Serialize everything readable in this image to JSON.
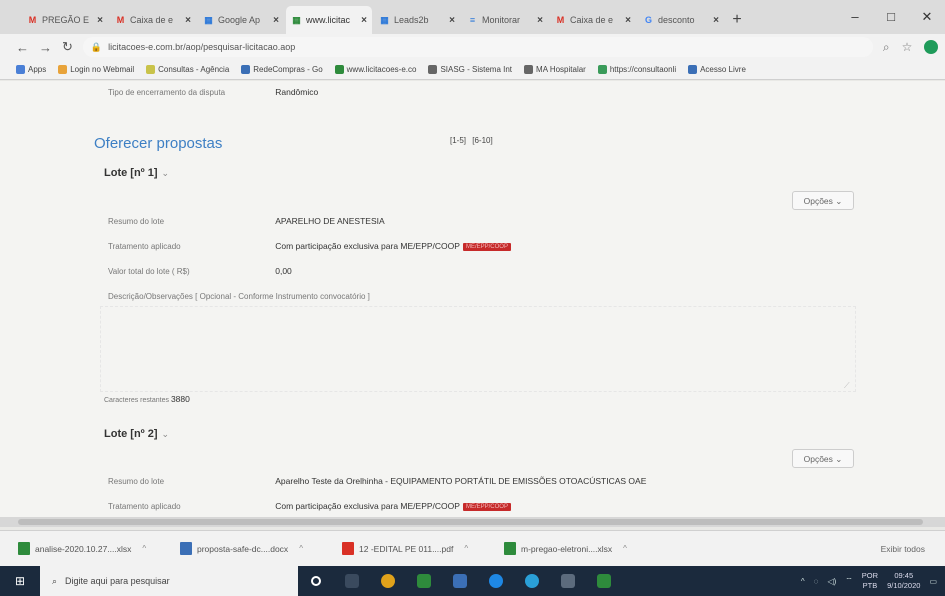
{
  "browser": {
    "tabs": [
      {
        "icon": "M",
        "icon_color": "#d93025",
        "title": "PREGÃO E",
        "active": false
      },
      {
        "icon": "M",
        "icon_color": "#d93025",
        "title": "Caixa de e",
        "active": false
      },
      {
        "icon": "▦",
        "icon_color": "#2f7ad9",
        "title": "Google Ap",
        "active": false
      },
      {
        "icon": "▦",
        "icon_color": "#2e8b3c",
        "title": "www.licitac",
        "active": true
      },
      {
        "icon": "▦",
        "icon_color": "#2f7ad9",
        "title": "Leads2b",
        "active": false
      },
      {
        "icon": "≡",
        "icon_color": "#2f7ad9",
        "title": "Monitorar",
        "active": false
      },
      {
        "icon": "M",
        "icon_color": "#d93025",
        "title": "Caixa de e",
        "active": false
      },
      {
        "icon": "G",
        "icon_color": "#4285f4",
        "title": "desconto",
        "active": false
      }
    ],
    "new_tab": "+",
    "minimize": "–",
    "maximize": "□",
    "close": "✕",
    "url": "licitacoes-e.com.br/aop/pesquisar-licitacao.aop",
    "bookmarks": [
      {
        "label": "Apps",
        "color": "#4a7fd6"
      },
      {
        "label": "Login no Webmail",
        "color": "#e8a33a"
      },
      {
        "label": "Consultas - Agência",
        "color": "#c9c34a"
      },
      {
        "label": "RedeCompras - Go",
        "color": "#3b6fb6"
      },
      {
        "label": "www.licitacoes-e.co",
        "color": "#2e8b3c"
      },
      {
        "label": "SIASG - Sistema Int",
        "color": "#666666"
      },
      {
        "label": "MA Hospitalar",
        "color": "#666666"
      },
      {
        "label": "https://consultaonli",
        "color": "#3a9b5a"
      },
      {
        "label": "Acesso Livre",
        "color": "#3b6fb6"
      }
    ]
  },
  "page": {
    "tipo_label": "Tipo de encerramento da disputa",
    "tipo_value": "Randômico",
    "pager": [
      "[1-5]",
      "[6-10]"
    ],
    "section_title": "Oferecer propostas",
    "lote1": {
      "title": "Lote [nº 1]",
      "dropdown": "⌄",
      "options_label": "Opções ⌄",
      "resumo_label": "Resumo do lote",
      "resumo_value": "APARELHO DE ANESTESIA",
      "tratamento_label": "Tratamento aplicado",
      "tratamento_value": "Com participação exclusiva para ME/EPP/COOP",
      "tratamento_tag": "ME/EPP/COOP",
      "valor_label": "Valor total do lote ( R$)",
      "valor_value": "0,00",
      "descricao_label": "Descrição/Observações [ Opcional - Conforme Instrumento convocatório ]",
      "resize_mark": "⟋"
    },
    "caracteres_label": "Caracteres restantes",
    "caracteres_value": "3880",
    "lote2": {
      "title": "Lote [nº 2]",
      "dropdown": "⌄",
      "options_label": "Opções ⌄",
      "resumo_label": "Resumo do lote",
      "resumo_value": "Aparelho Teste da Orelhinha - EQUIPAMENTO PORTÁTIL DE EMISSÕES OTOACÚSTICAS OAE",
      "tratamento_label": "Tratamento aplicado",
      "tratamento_value": "Com participação exclusiva para ME/EPP/COOP",
      "tratamento_tag": "ME/EPP/COOP"
    }
  },
  "downloads": {
    "items": [
      {
        "name": "analise-2020.10.27....xlsx",
        "color": "#2e8b3c"
      },
      {
        "name": "proposta-safe-dc....docx",
        "color": "#3b6fb6"
      },
      {
        "name": "12 -EDITAL PE 011....pdf",
        "color": "#d93025"
      },
      {
        "name": "m-pregao-eletroni....xlsx",
        "color": "#2e8b3c"
      }
    ],
    "chevron": "^",
    "show_all": "Exibir todos"
  },
  "taskbar": {
    "start": "⊞",
    "search_placeholder": "Digite aqui para pesquisar",
    "search_icon": "⌕",
    "clock_time": "09:45",
    "clock_date": "9/10/2020",
    "lang": "POR",
    "lang2": "PTB",
    "tray_chevron": "^"
  }
}
